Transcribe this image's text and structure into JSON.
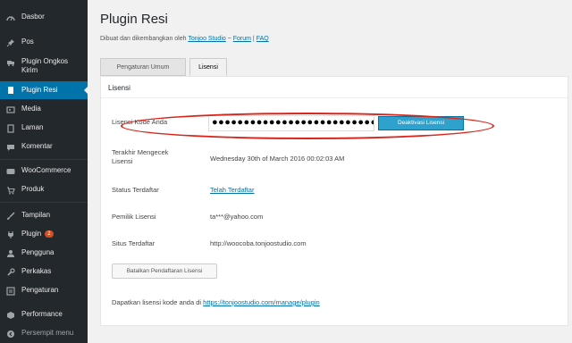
{
  "sidebar": {
    "items": [
      {
        "label": "Dasbor",
        "icon": "dashboard-icon"
      },
      {
        "label": "Pos",
        "icon": "pin-icon"
      },
      {
        "label": "Plugin Ongkos Kirim",
        "icon": "truck-icon"
      },
      {
        "label": "Plugin Resi",
        "icon": "receipt-icon"
      },
      {
        "label": "Media",
        "icon": "media-icon"
      },
      {
        "label": "Laman",
        "icon": "page-icon"
      },
      {
        "label": "Komentar",
        "icon": "comment-icon"
      },
      {
        "label": "WooCommerce",
        "icon": "woocommerce-icon"
      },
      {
        "label": "Produk",
        "icon": "cart-icon"
      },
      {
        "label": "Tampilan",
        "icon": "brush-icon"
      },
      {
        "label": "Plugin",
        "icon": "plugin-icon",
        "badge": "2"
      },
      {
        "label": "Pengguna",
        "icon": "users-icon"
      },
      {
        "label": "Perkakas",
        "icon": "wrench-icon"
      },
      {
        "label": "Pengaturan",
        "icon": "settings-icon"
      },
      {
        "label": "Performance",
        "icon": "gauge-icon"
      },
      {
        "label": "Persempit menu",
        "icon": "collapse-icon"
      }
    ]
  },
  "page": {
    "title": "Plugin Resi",
    "subline_prefix": "Dibuat dan dikembangkan oleh",
    "subline_author": "Tonjoo Studio",
    "subline_sep1": " ~ ",
    "subline_forum": "Forum",
    "subline_sep2": " | ",
    "subline_faq": "FAQ"
  },
  "tabs": [
    {
      "label": "Pengaturan Umum"
    },
    {
      "label": "Lisensi"
    }
  ],
  "panel": {
    "title": "Lisensi",
    "license_label": "Lisensi Kode Anda",
    "license_value": "●●●●●●●●●●●●●●●●●●●●●●●●●●●●",
    "deactivate_label": "Deaktivasi Lisensi",
    "last_checked_label": "Terakhir Mengecek Lisensi",
    "last_checked_value": "Wednesday 30th of March 2016 00:02:03 AM",
    "status_label": "Status Terdaftar",
    "status_value": "Telah Terdaftar",
    "owner_label": "Pemilik Lisensi",
    "owner_value": "ta***@yahoo.com",
    "site_label": "Situs Terdaftar",
    "site_value": "http://woocoba.tonjoostudio.com",
    "remove_label": "Batalkan Pendaftaran Lisensi",
    "footer_prefix": "Dapatkan lisensi kode anda di",
    "footer_link": "https://tonjoostudio.com/manage/plugin"
  },
  "colors": {
    "sidebar_bg": "#23282d",
    "active_bg": "#0073aa",
    "button_blue": "#2ea2cc",
    "highlight_red": "#d9261c"
  }
}
